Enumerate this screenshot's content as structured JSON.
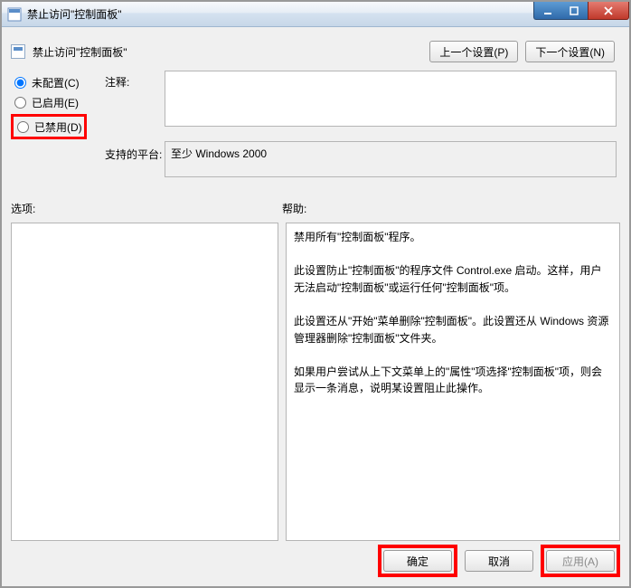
{
  "window": {
    "title": "禁止访问\"控制面板\""
  },
  "header": {
    "setting_title": "禁止访问\"控制面板\"",
    "prev_label": "上一个设置(P)",
    "next_label": "下一个设置(N)"
  },
  "radios": {
    "not_configured": "未配置(C)",
    "enabled": "已启用(E)",
    "disabled": "已禁用(D)",
    "selected": "not_configured"
  },
  "labels": {
    "comment": "注释:",
    "platform": "支持的平台:",
    "options": "选项:",
    "help": "帮助:"
  },
  "comment_value": "",
  "platform_value": "至少 Windows 2000",
  "help_text": "禁用所有\"控制面板\"程序。\n\n此设置防止\"控制面板\"的程序文件 Control.exe 启动。这样，用户无法启动\"控制面板\"或运行任何\"控制面板\"项。\n\n此设置还从\"开始\"菜单删除\"控制面板\"。此设置还从 Windows 资源管理器删除\"控制面板\"文件夹。\n\n如果用户尝试从上下文菜单上的\"属性\"项选择\"控制面板\"项，则会显示一条消息，说明某设置阻止此操作。",
  "footer": {
    "ok": "确定",
    "cancel": "取消",
    "apply": "应用(A)"
  }
}
